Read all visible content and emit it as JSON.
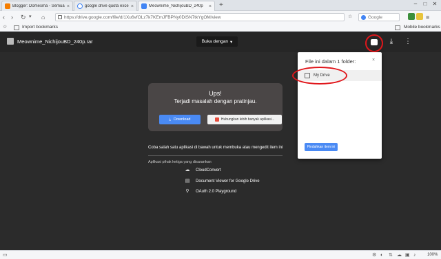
{
  "browser": {
    "tabs": [
      {
        "title": "Blogger: Domesma - Semua",
        "favicon_color": "#f57d00",
        "active": false
      },
      {
        "title": "google drive quota exceeded",
        "favicon_color": "#4285f4",
        "active": false
      },
      {
        "title": "Meownime_NichijouBD_240p",
        "favicon_color": "#4285f4",
        "active": true
      }
    ],
    "url": "https://drive.google.com/file/d/1Xu6vfOLz7k7KEmJFBPNy0DlSN7tkYgOM/view",
    "search_placeholder": "Google",
    "bookmarks": {
      "import_label": "Import bookmarks",
      "mobile_label": "Mobile bookmarks"
    }
  },
  "viewer": {
    "filename": "Meownime_NichijouBD_240p.rar",
    "open_with_label": "Buka dengan",
    "error": {
      "title": "Ups!",
      "message": "Terjadi masalah dengan pratinjau.",
      "download_label": "Download",
      "connect_label": "Hubungkan lebih banyak aplikasi..."
    },
    "try_text": "Coba salah satu aplikasi di bawah untuk membuka atau mengedit item ini",
    "third_party_header": "Aplikasi pihak ketiga yang disarankan",
    "apps": [
      {
        "name": "CloudConvert",
        "icon": "cloud-icon"
      },
      {
        "name": "Document Viewer for Google Drive",
        "icon": "document-icon"
      },
      {
        "name": "OAuth 2.0 Playground",
        "icon": "oauth-icon"
      }
    ],
    "folder_popup": {
      "title": "File ini dalam 1 folder:",
      "folder_name": "My Drive",
      "move_label": "Pindahkan item ini"
    }
  },
  "status": {
    "zoom": "100%"
  },
  "colors": {
    "accent_blue": "#4a8af4",
    "annotation_red": "#e0161b"
  }
}
